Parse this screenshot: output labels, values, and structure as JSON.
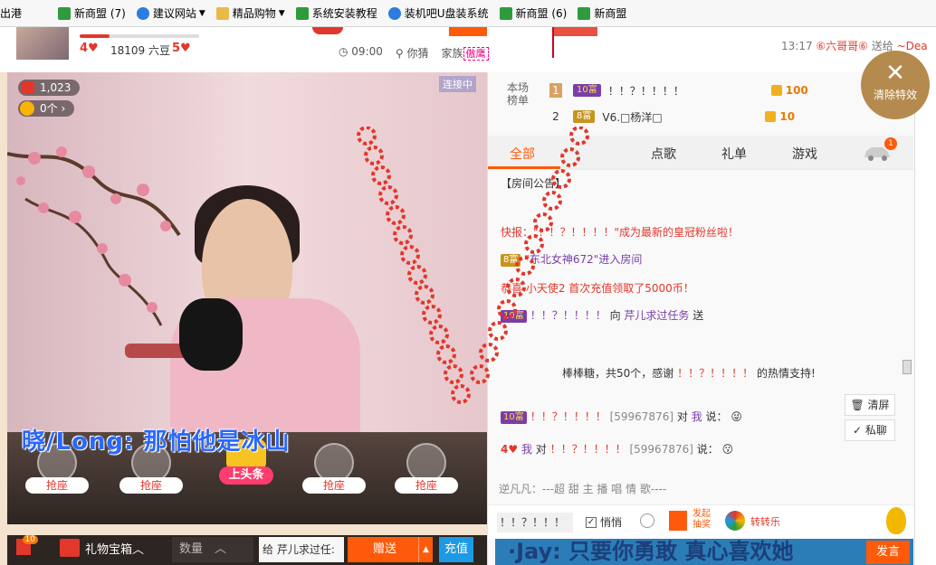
{
  "bookmarks": [
    {
      "label": "出港",
      "icon": "none"
    },
    {
      "label": "新商盟 (7)",
      "icon": "green"
    },
    {
      "label": "建议网站",
      "icon": "ie",
      "dropdown": true
    },
    {
      "label": "精品购物",
      "icon": "folder",
      "dropdown": true
    },
    {
      "label": "系统安装教程",
      "icon": "green"
    },
    {
      "label": "装机吧U盘装系统",
      "icon": "ie"
    },
    {
      "label": "新商盟 (6)",
      "icon": "green"
    },
    {
      "label": "新商盟",
      "icon": "green"
    }
  ],
  "top": {
    "level_left": "4",
    "level_right": "5",
    "beans": "18109 六豆",
    "time": "09:00",
    "guess": "你猜",
    "family": "家族",
    "family_badge": "傲鹰",
    "right_time": "13:17",
    "right_user": "⑥六哥哥⑥",
    "right_action": "送给",
    "right_target": "~Dea",
    "level_progress": 0.25
  },
  "video": {
    "online_count": "1,023",
    "sub_count": "0个",
    "live_tag": "连接中",
    "lyric": "晓/Long:  那怕他是冰山",
    "seats": [
      "抢座",
      "抢座",
      "抢座",
      "抢座",
      "抢座"
    ],
    "headline": "上头条"
  },
  "giftbar": {
    "badge": "10",
    "giftbox": "礼物宝箱",
    "qty_placeholder": "数量",
    "to_prefix": "给",
    "to_user": "芹儿求过任:",
    "send": "赠送",
    "recharge": "充值"
  },
  "clear_effect": "清除特效",
  "panel": {
    "rank_title": "本场\n榜单",
    "ranks": [
      {
        "num": "1",
        "badge": "10富",
        "name": "！！？！！！！",
        "value": "100"
      },
      {
        "num": "2",
        "badge": "8富",
        "name": "V6.□杨洋□",
        "value": "10"
      }
    ],
    "tabs": [
      "全部",
      "点歌",
      "礼单",
      "游戏"
    ],
    "car_badge": "1",
    "announcement": "【房间公告】",
    "messages": {
      "m1": "快报：\"！！？！！！！\"成为最新的皇冠粉丝啦！",
      "m2_badge": "8富",
      "m2": "\"东北女神672\"进入房间",
      "m3": "恭喜 小天使2 首次充值领取了5000币！",
      "m4_badge": "10富",
      "m4_user": "！！？！！！！",
      "m4_to": "向",
      "m4_target": "芹儿求过任务",
      "m4_send": "送",
      "m5": "棒棒糖，共50个，感谢",
      "m5_user": "！！？！！！！",
      "m5_end": "的热情支持!",
      "m6_badge": "10富",
      "m6_user": "！！？！！！！",
      "m6_id": "[59967876]",
      "m6_to": "对",
      "m6_me": "我",
      "m6_say": "说：",
      "m7_me": "我",
      "m7_to": "对",
      "m7_user": "！！？！！！！",
      "m7_id": "[59967876]",
      "m7_say": "说："
    },
    "clear_screen": "清屏",
    "private_chat": "私聊",
    "notice": "逆凡凡：---超 甜 主 播 唱 情 歌----",
    "input_value": "！！？！！！",
    "quiet": "悄悄",
    "launch": "发起\n抽奖",
    "spin": "转转乐",
    "banner": "·Jay:  只要你勇敢  真心喜欢她",
    "send_chat": "发言"
  }
}
